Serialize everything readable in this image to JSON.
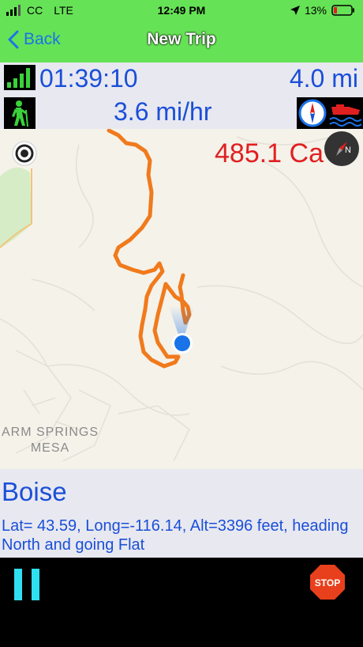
{
  "status_bar": {
    "carrier": "CC",
    "network": "LTE",
    "time": "12:49 PM",
    "battery": "13%"
  },
  "nav": {
    "back_label": "Back",
    "title": "New Trip"
  },
  "stats": {
    "duration": "01:39:10",
    "distance": "4.0 mi",
    "speed": "3.6 mi/hr"
  },
  "map": {
    "calories": "485.1 Ca",
    "area_label_line1": "ARM SPRINGS",
    "area_label_line2": "MESA"
  },
  "info": {
    "city": "Boise",
    "coordinates": "Lat= 43.59, Long=-116.14, Alt=3396 feet, heading North and going Flat"
  },
  "controls": {
    "stop_label": "STOP"
  },
  "colors": {
    "header_green": "#66e256",
    "text_blue": "#1a4fd8",
    "route_orange": "#f07a1c",
    "calorie_red": "#e02020",
    "pause_cyan": "#2fe0f0",
    "stop_red": "#e8401c"
  },
  "icons": {
    "signal": "signal-bars-icon",
    "location": "location-arrow-icon",
    "battery": "battery-icon",
    "back": "chevron-left-icon",
    "gps": "gps-strength-icon",
    "activity": "hiker-icon",
    "compass": "compass-icon",
    "boat": "boat-icon",
    "map_compass": "map-compass-icon",
    "locate": "tracking-mode-icon",
    "current_location": "current-location-dot-icon",
    "pause": "pause-icon",
    "stop": "stop-sign-icon"
  }
}
